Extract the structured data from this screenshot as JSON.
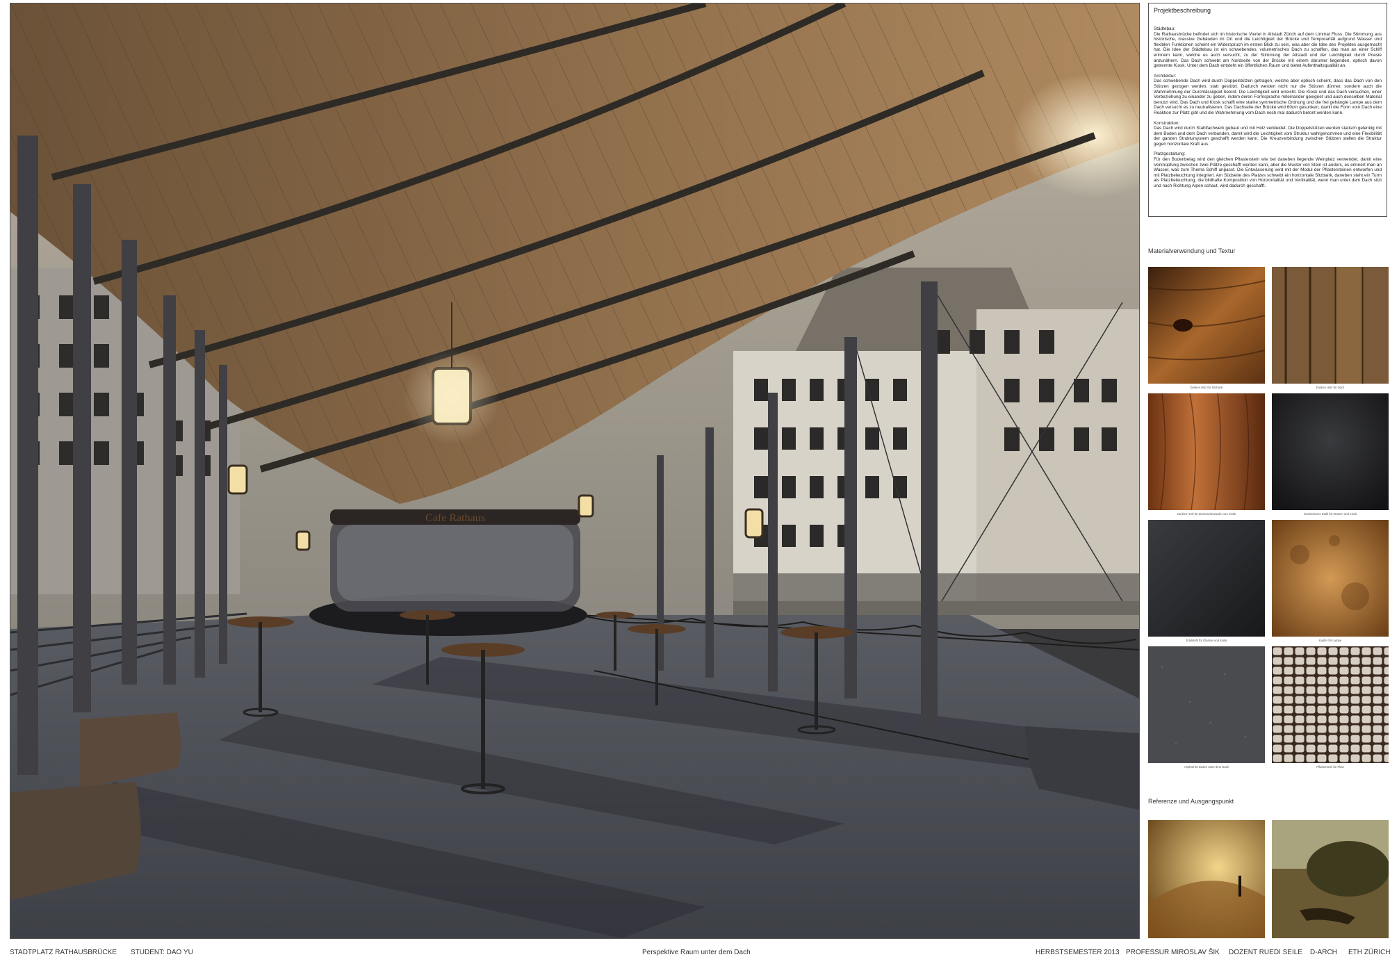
{
  "footer": {
    "project": "STADTPLATZ RATHAUSBRÜCKE",
    "student": "STUDENT: DAO YU",
    "view": "Perspektive Raum unter dem Dach",
    "semester": "HERBSTSEMESTER  2013",
    "professor": "PROFESSUR MIROSLAV ŠIK",
    "dozent": "DOZENT RUEDI SEILE",
    "dept": "D-ARCH",
    "school": "ETH ZÜRICH"
  },
  "render": {
    "kiosk_sign": "Cafe Rathaus"
  },
  "description": {
    "heading": "Projektbeschreibung",
    "sections": [
      {
        "title": "Städtebau:",
        "body": "Die Rathausbrücke befindet sich im historische Viertel in Altstadt Zürich auf dem Limmat Fluss. Die Stimmung aus historische, massive Gebäuden im Ort und die Leichtigkeit der Brücke und Temporarität aufgrund Wasser und flexiblen Funktionen scheint ein Widerspruch im ersten Blick zu sein, was aber die Idee des Projektes ausgemacht hat. Die Idee der Städtebau ist ein schwebendes, volumetrisches Dach zu schaffen, das man an einer Schiff erinnern kann, welche es auch versucht, zu der Stimmung der Altstadt und der Leichtigkeit durch Poesie anzunähern. Das Dach schwebt am Nordseite von der Brücke mit einem darunter liegenden, optisch davon getrennte Kiosk. Unter dem Dach entsteht ein öffentlichen Raum und bietet Aufenthaltsqualität an."
      },
      {
        "title": "Architektur:",
        "body": "Das schwebende Dach wird durch Doppelstützen getragen, welche aber optisch scheint, dass das Dach von den Stützen gezogen werden, statt gestützt. Dadurch werden nicht nur die Stützen dünner, sondern auch die Wahrnehmung der Durchlässigkeit betont. Die Leichtigkeit wird erreicht. Die Kiosk und das Dach versuchen, einer Verbeziehung zu einander zu geben, indem deren Formsprache miteinander geeignet und auch denselben Material benutzt wird. Das Dach und Kiosk schafft eine starke symmetrische Ordnung und die frei gehängte Lampe aus dem Dach versucht es zu neutralisieren. Das Dachseite der Brücke wird 60cm gesunken, damit die Form vom Dach eine Reaktion zur Platz gibt und die Wahrnehmung vom Dach noch mal dadurch betont werden kann."
      },
      {
        "title": "Konstruktion:",
        "body": "Das Dach wird durch Stahlfachwerk gebaut und mit Holz verkleidet. Die Doppelstützen werden statisch gelenkig mit dem Boden und dem Dach verbunden, damit wird die Leichtigkeit vom Struktur wahrgenommen und eine Flexibilität der ganzen Struktursystem geschafft werden kann. Die Kreuzverbindung zwischen Stützen stellen die Struktur gegen horizontale Kraft aus."
      },
      {
        "title": "Platzgestaltung:",
        "body": "Für den Bodenbelag wird den gleichen Pflasterstein wie bei daneben liegende Weinplatz verwendet, damit eine Verknüpfung zwischen zwei Plätze geschafft werden kann, aber die Muster von Stein ist anders, es erinnert man an Wasser, was zum Thema Schiff anpasst. Die Entwässerung wird mit der Modul der Pflastersteinen entworfen und mit Platzbeleuchtung integriert. Am Südseite des Platzes schwebt ein horizontale Sitzbank, daneben steht ein Turm als Platzbeleuchtung, die bildhafte Komposition von Horizontalität und Vertikalität, wenn man unter dem Dach sitzt und nach Richtung Alpen schaut, wird dadurch geschafft."
      }
    ]
  },
  "materials": {
    "title": "Materialverwendung und Textur",
    "items": [
      {
        "caption": "Dunkes Holz für Sitzbank",
        "icon": "wood-knot-texture"
      },
      {
        "caption": "Dunkes Holz für Dach",
        "icon": "wood-planks-texture"
      },
      {
        "caption": "Dunkes Holz für Decksseitewände vom Kiosk",
        "icon": "wood-grain-texture"
      },
      {
        "caption": "Gestrichenes Stahl für Stützen und Kiosk",
        "icon": "dark-steel-texture"
      },
      {
        "caption": "Edelstahl für Glasrae und Kiosk",
        "icon": "black-steel-texture"
      },
      {
        "caption": "Kupfer für Lampe",
        "icon": "copper-texture"
      },
      {
        "caption": "Asphalt für Boden unter dem Dach",
        "icon": "asphalt-texture"
      },
      {
        "caption": "Pflasterstein für Platz",
        "icon": "cobblestone-texture"
      }
    ]
  },
  "references": {
    "title": "Referenze und Ausgangspunkt"
  }
}
